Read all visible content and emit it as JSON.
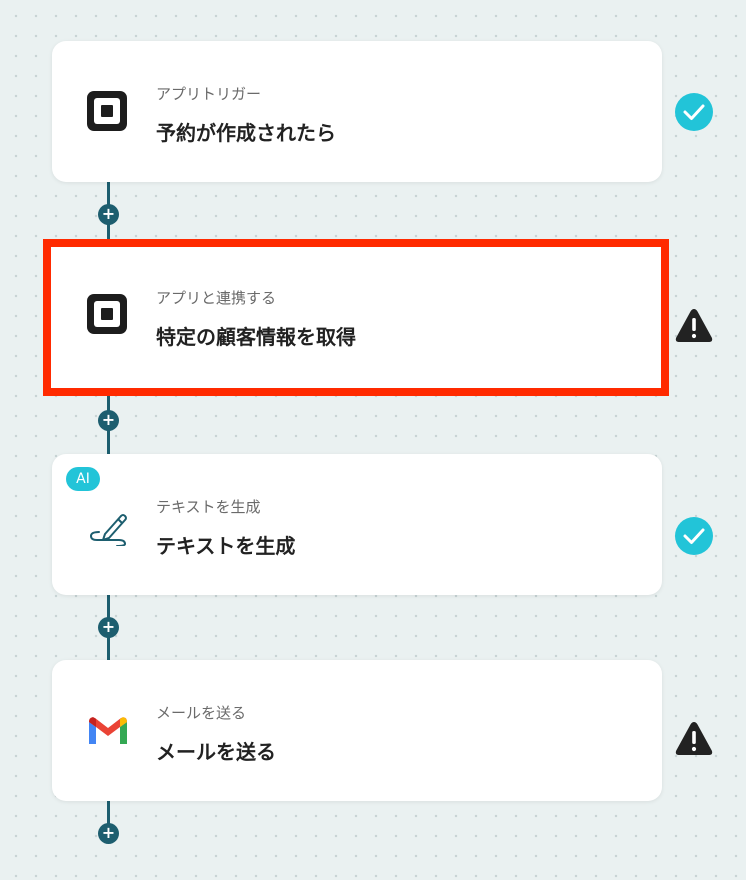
{
  "steps": [
    {
      "sub": "アプリトリガー",
      "title": "予約が作成されたら",
      "icon": "square-app-icon",
      "status": "check"
    },
    {
      "sub": "アプリと連携する",
      "title": "特定の顧客情報を取得",
      "icon": "square-app-icon",
      "status": "warning",
      "highlighted": true
    },
    {
      "sub": "テキストを生成",
      "title": "テキストを生成",
      "icon": "pen-icon",
      "status": "check",
      "badge": "AI"
    },
    {
      "sub": "メールを送る",
      "title": "メールを送る",
      "icon": "gmail-icon",
      "status": "warning"
    }
  ],
  "add_button_label": "+",
  "colors": {
    "connector": "#1d5e6f",
    "check": "#22c4d8",
    "warning": "#222222",
    "highlight_border": "#ff2a00"
  }
}
